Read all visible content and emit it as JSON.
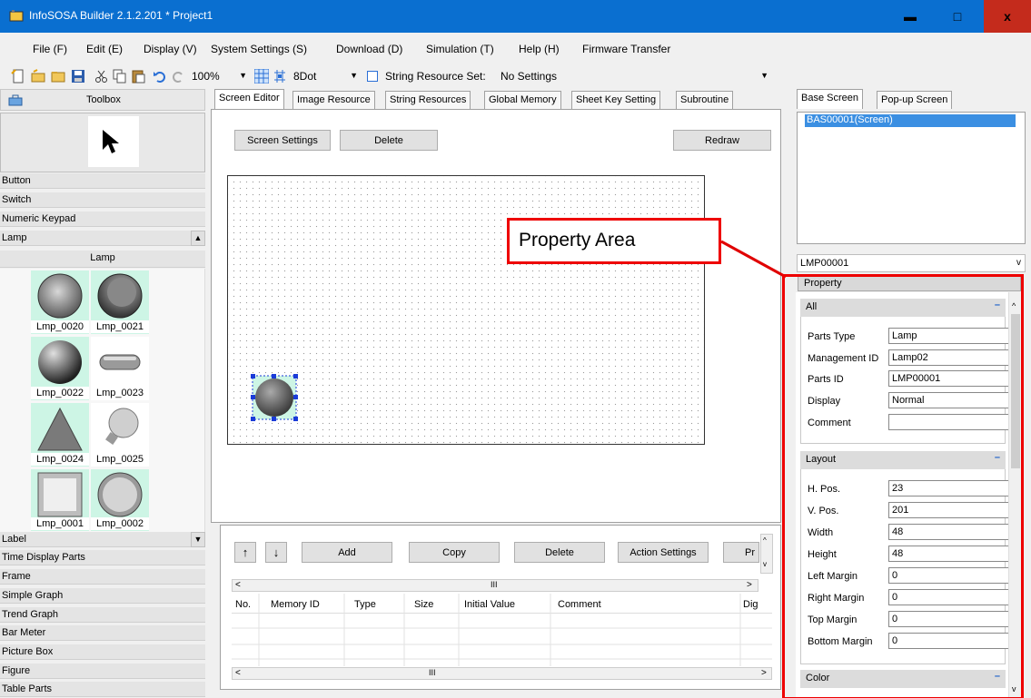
{
  "window": {
    "title": "InfoSOSA Builder 2.1.2.201 * Project1",
    "controls": {
      "minimize": "▬",
      "maximize": "□",
      "close": "x"
    }
  },
  "menu": [
    "File (F)",
    "Edit (E)",
    "Display (V)",
    "System Settings (S)",
    "Download (D)",
    "Simulation (T)",
    "Help (H)",
    "Firmware Transfer"
  ],
  "toolbar": {
    "zoom": "100%",
    "grid": "8Dot",
    "string_resource_label": "String Resource Set:",
    "string_resource_value": "No Settings"
  },
  "toolbox": {
    "title": "Toolbox",
    "categories_top": [
      "Button",
      "Switch",
      "Numeric Keypad",
      "Lamp"
    ],
    "lamp_subheader": "Lamp",
    "lamps": [
      "Lmp_0020",
      "Lmp_0021",
      "Lmp_0022",
      "Lmp_0023",
      "Lmp_0024",
      "Lmp_0025",
      "Lmp_0001",
      "Lmp_0002"
    ],
    "categories_bottom": [
      "Label",
      "Time Display Parts",
      "Frame",
      "Simple Graph",
      "Trend Graph",
      "Bar Meter",
      "Picture Box",
      "Figure",
      "Table Parts"
    ]
  },
  "center_tabs": [
    "Screen Editor",
    "Image Resource",
    "String Resources",
    "Global Memory",
    "Sheet Key Setting",
    "Subroutine"
  ],
  "editor": {
    "screen_settings": "Screen Settings",
    "delete": "Delete",
    "redraw": "Redraw"
  },
  "memory_panel": {
    "up": "↑",
    "down": "↓",
    "add": "Add",
    "copy": "Copy",
    "delete": "Delete",
    "action_settings": "Action Settings",
    "more": "Pr",
    "scroll_mark": "III",
    "columns": [
      "No.",
      "Memory ID",
      "Type",
      "Size",
      "Initial Value",
      "Comment",
      "Dig"
    ]
  },
  "right_tabs": [
    "Base Screen",
    "Pop-up Screen"
  ],
  "screens": [
    "BAS00001(Screen)"
  ],
  "selected_part": "LMP00001",
  "property_header": "Property",
  "groups": {
    "all": {
      "title": "All",
      "rows": [
        {
          "label": "Parts Type",
          "value": "Lamp"
        },
        {
          "label": "Management ID",
          "value": "Lamp02"
        },
        {
          "label": "Parts ID",
          "value": "LMP00001"
        },
        {
          "label": "Display",
          "value": "Normal"
        },
        {
          "label": "Comment",
          "value": ""
        }
      ]
    },
    "layout": {
      "title": "Layout",
      "rows": [
        {
          "label": "H. Pos.",
          "value": "23"
        },
        {
          "label": "V. Pos.",
          "value": "201"
        },
        {
          "label": "Width",
          "value": "48"
        },
        {
          "label": "Height",
          "value": "48"
        },
        {
          "label": "Left Margin",
          "value": "0"
        },
        {
          "label": "Right Margin",
          "value": "0"
        },
        {
          "label": "Top Margin",
          "value": "0"
        },
        {
          "label": "Bottom Margin",
          "value": "0"
        }
      ]
    },
    "color": {
      "title": "Color"
    }
  },
  "annotation": "Property Area",
  "colors": {
    "title_bar": "#0a6fd0",
    "close": "#c42b1c",
    "annotation": "#e00000",
    "selection": "#3b8fe2",
    "lamp_bg": "#cdf5e5"
  }
}
